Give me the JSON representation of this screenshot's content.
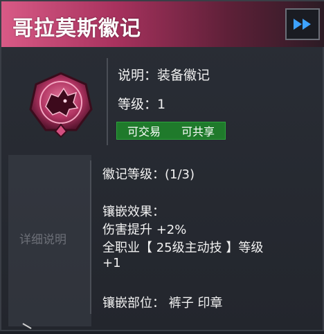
{
  "header": {
    "title": "哥拉莫斯徽记",
    "skip_icon": "fast-forward-icon"
  },
  "item": {
    "emblem_icon": "dragon-emblem-icon",
    "description": "说明：装备徽记",
    "level": "等级：1",
    "tags": [
      "可交易",
      "可共享"
    ]
  },
  "detail": {
    "sidebar_label": "详细说明",
    "emblem_grade": "徽记等级：(1/3)",
    "inlay_effect_heading": "镶嵌效果：",
    "effect_line_1": "伤害提升 +2%",
    "effect_line_2": "全职业【 25级主动技 】等级",
    "effect_line_3": "+1",
    "inlay_slots": "镶嵌部位： 裤子 印章"
  },
  "colors": {
    "header_accent": "#c8467a",
    "tag_green": "#1f7a2b",
    "emblem_pink": "#c23a6a"
  }
}
